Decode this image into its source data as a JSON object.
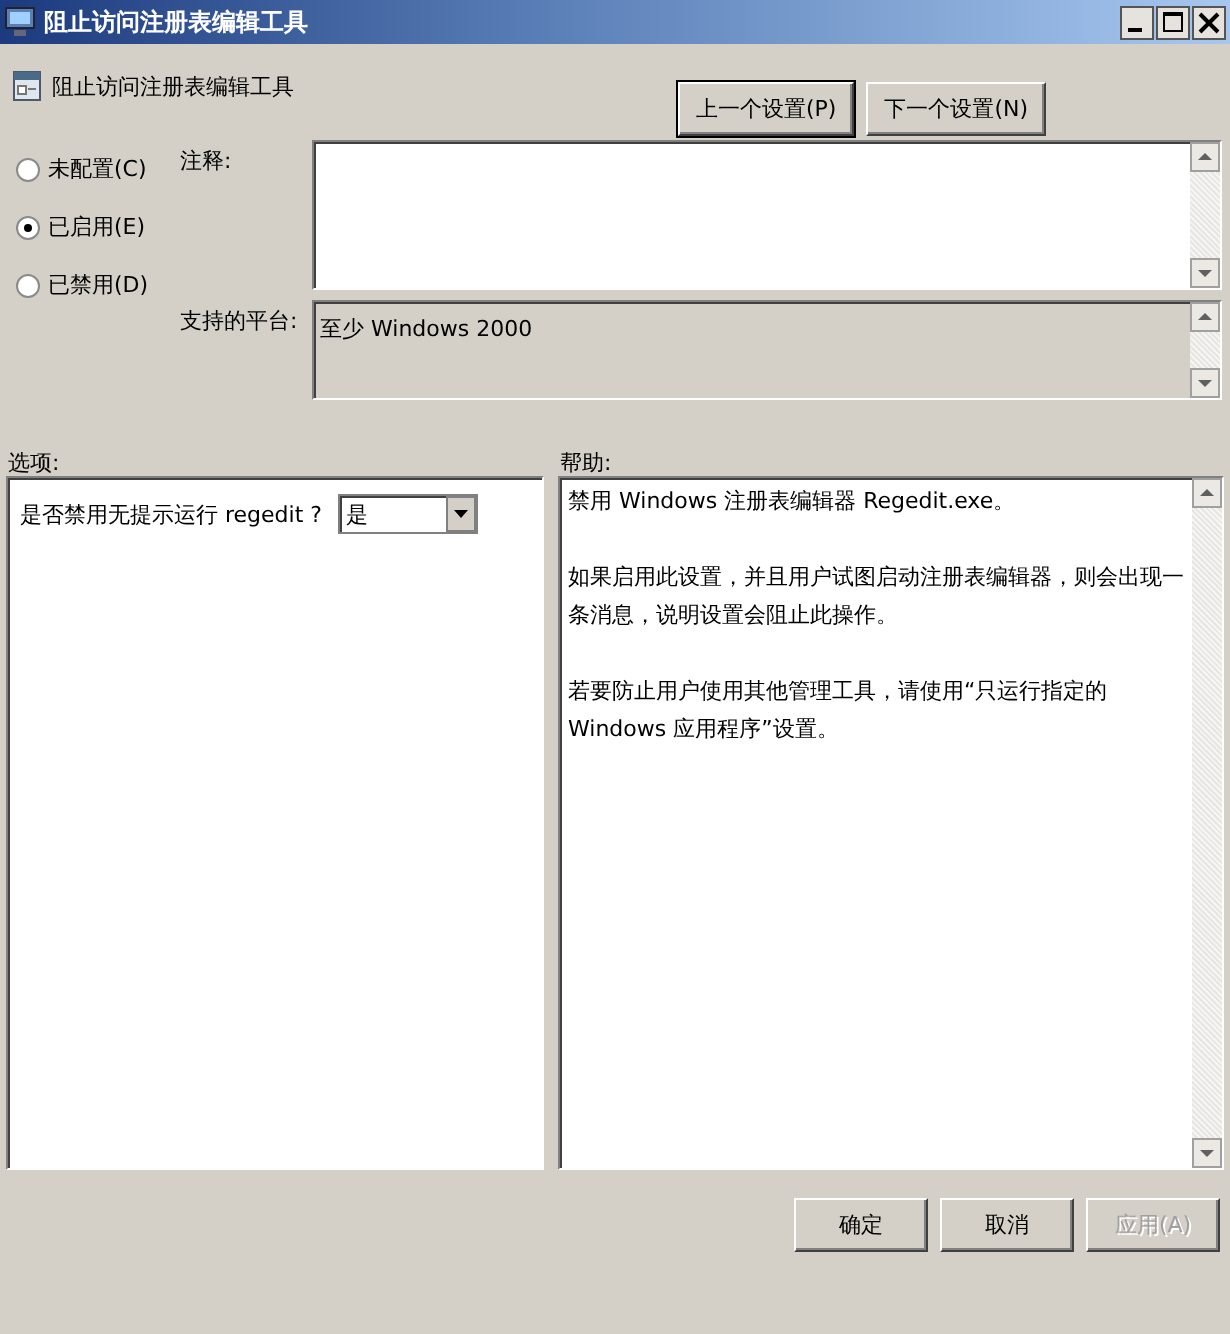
{
  "window": {
    "title": "阻止访问注册表编辑工具"
  },
  "header": {
    "policy_name": "阻止访问注册表编辑工具",
    "buttons": [
      {
        "label": "上一个设置(P)",
        "default": true
      },
      {
        "label": "下一个设置(N)",
        "default": false
      }
    ]
  },
  "state_options": [
    {
      "label": "未配置(C)",
      "selected": false
    },
    {
      "label": "已启用(E)",
      "selected": true
    },
    {
      "label": "已禁用(D)",
      "selected": false
    }
  ],
  "comment": {
    "label": "注释:"
  },
  "platform": {
    "label": "支持的平台:",
    "value": "至少 Windows 2000"
  },
  "options": {
    "label": "选项:",
    "prompt": "是否禁用无提示运行 regedit ?",
    "dropdown_value": "是"
  },
  "help": {
    "label": "帮助:",
    "paragraphs": [
      "禁用 Windows 注册表编辑器 Regedit.exe。",
      "如果启用此设置，并且用户试图启动注册表编辑器，则会出现一条消息，说明设置会阻止此操作。",
      "若要防止用户使用其他管理工具，请使用“只运行指定的 Windows 应用程序”设置。"
    ]
  },
  "buttons": [
    {
      "label": "确定",
      "disabled": false
    },
    {
      "label": "取消",
      "disabled": false
    },
    {
      "label": "应用(A)",
      "disabled": true
    }
  ]
}
